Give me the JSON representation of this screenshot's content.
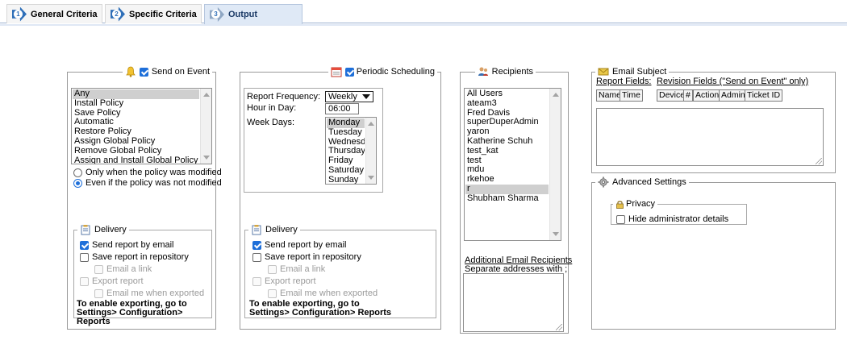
{
  "tabs": [
    {
      "label": "General Criteria",
      "num": "1"
    },
    {
      "label": "Specific Criteria",
      "num": "2"
    },
    {
      "label": "Output",
      "num": "3"
    }
  ],
  "send_on_event": {
    "title": "Send on Event",
    "checked": true,
    "events": [
      "Any",
      "Install Policy",
      "Save Policy",
      "Automatic",
      "Restore Policy",
      "Assign Global Policy",
      "Remove Global Policy",
      "Assign and Install Global Policy"
    ],
    "selected": "Any",
    "radio_modified": "Only when the policy was modified",
    "radio_not_modified": "Even if the policy was not modified",
    "radio_selected": "not_modified"
  },
  "delivery_left": {
    "title": "Delivery",
    "send_email": "Send report by email",
    "save_repo": "Save report in repository",
    "email_link": "Email a link",
    "export_report": "Export report",
    "email_exported": "Email me when exported",
    "note": "To enable exporting, go to Settings> Configuration> Reports"
  },
  "periodic": {
    "title": "Periodic Scheduling",
    "checked": true,
    "freq_label": "Report Frequency:",
    "freq_value": "Weekly",
    "hour_label": "Hour in Day:",
    "hour_value": "06:00",
    "days_label": "Week Days:",
    "days": [
      "Monday",
      "Tuesday",
      "Wednesday",
      "Thursday",
      "Friday",
      "Saturday",
      "Sunday"
    ],
    "selected_day": "Monday"
  },
  "delivery_mid": {
    "title": "Delivery",
    "send_email": "Send report by email",
    "save_repo": "Save report in repository",
    "email_link": "Email a link",
    "export_report": "Export report",
    "email_exported": "Email me when exported",
    "note": "To enable exporting, go to Settings> Configuration> Reports"
  },
  "recipients": {
    "title": "Recipients",
    "users": [
      "All Users",
      "ateam3",
      "Fred Davis",
      "superDuperAdmin",
      "yaron",
      "Katherine Schuh",
      "test_kat",
      "test",
      "mdu",
      "rkehoe",
      "r",
      "Shubham Sharma"
    ],
    "selected": "r",
    "additional_label": "Additional Email Recipients",
    "separator_hint": "Separate addresses with ;"
  },
  "email_subject": {
    "title": "Email Subject",
    "report_fields_label": "Report Fields:",
    "revision_fields_label": "Revision Fields (\"Send on Event\" only)",
    "report_fields": [
      "Name",
      "Time"
    ],
    "revision_fields": [
      "Device",
      "#",
      "Action",
      "Admin",
      "Ticket ID"
    ]
  },
  "advanced": {
    "title": "Advanced Settings",
    "privacy_title": "Privacy",
    "hide_admin": "Hide administrator details"
  },
  "colors": {
    "accent": "#1e6fd9",
    "tab_active_bg": "#dfe9f6",
    "selection": "#cfcfcf"
  }
}
